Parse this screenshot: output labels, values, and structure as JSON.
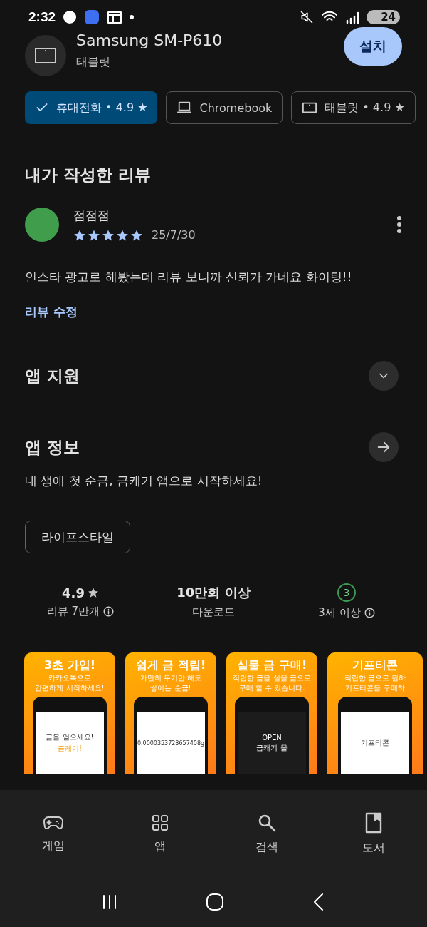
{
  "status_bar": {
    "time": "2:32",
    "battery": "24"
  },
  "device": {
    "name": "Samsung SM-P610",
    "type": "태블릿",
    "install_button": "설치"
  },
  "device_chips": [
    {
      "kind": "phone",
      "label": "휴대전화 • 4.9 ★",
      "selected": true
    },
    {
      "kind": "laptop",
      "label": "Chromebook",
      "selected": false
    },
    {
      "kind": "tablet",
      "label": "태블릿 • 4.9 ★",
      "selected": false
    }
  ],
  "my_review": {
    "heading": "내가 작성한 리뷰",
    "author": "점점점",
    "stars": 5,
    "date": "25/7/30",
    "text": "인스타 광고로 해봤는데 리뷰 보니까 신뢰가 가네요 화이팅!!",
    "edit_link": "리뷰 수정"
  },
  "sections": [
    {
      "kind": "expand",
      "title": "앱 지원"
    },
    {
      "kind": "arrow",
      "title": "앱 정보"
    }
  ],
  "app_description": "내 생애 첫 순금, 금캐기 앱으로 시작하세요!",
  "category_chip": "라이프스타일",
  "stats": [
    {
      "kind": "rating",
      "value": "4.9",
      "label": "리뷰 7만개"
    },
    {
      "kind": "plain",
      "value": "10만회 이상",
      "label": "다운로드"
    },
    {
      "kind": "age",
      "value": "3",
      "label": "3세 이상"
    }
  ],
  "screenshots": [
    {
      "title": "3초 가입!",
      "subtitle": [
        "카카오톡으로",
        "간편하게 시작하세요!"
      ],
      "screen_text": [
        "금을 얻으세요!",
        "금캐기!"
      ]
    },
    {
      "title": "쉽게 금 적립!",
      "subtitle": [
        "가만히 두기만 해도",
        "쌓이는 순금!"
      ],
      "screen_text": [
        "0.0000353728657408g"
      ]
    },
    {
      "title": "실물 금 구매!",
      "subtitle": [
        "적립한 금을 실물 금으로",
        "구매 할 수 있습니다."
      ],
      "screen_text": [
        "OPEN",
        "금캐기 몰"
      ]
    },
    {
      "title": "기프티콘",
      "subtitle": [
        "적립한 금으로 원하",
        "기프티콘을 구매하"
      ],
      "screen_text": [
        "기프티콘"
      ]
    }
  ],
  "bottom_nav": [
    {
      "kind": "games",
      "label": "게임"
    },
    {
      "kind": "apps",
      "label": "앱"
    },
    {
      "kind": "search",
      "label": "검색"
    },
    {
      "kind": "books",
      "label": "도서"
    }
  ]
}
